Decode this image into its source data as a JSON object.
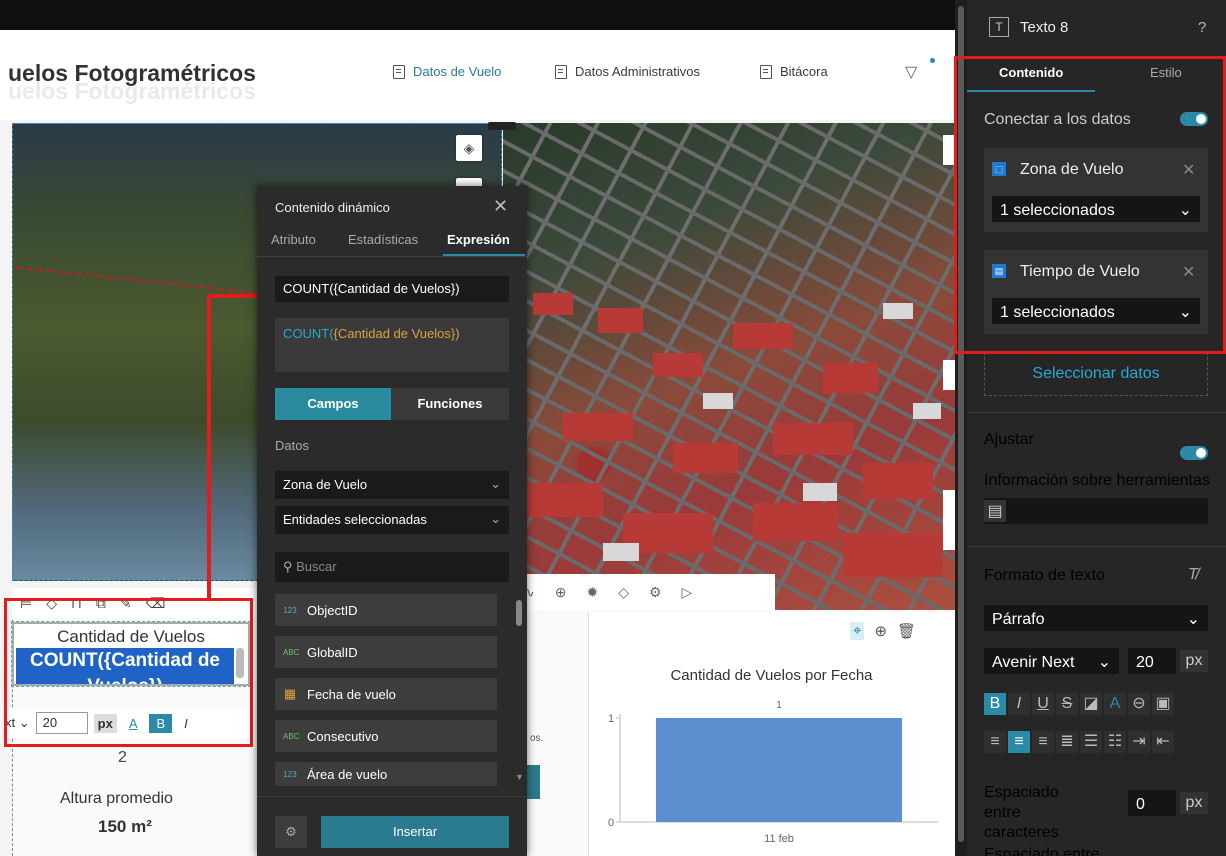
{
  "header": {
    "title": "uelos Fotogramétricos",
    "nav": [
      "Datos de Vuelo",
      "Datos Administrativos",
      "Bitácora"
    ]
  },
  "widget": {
    "label": "Cantidad de Vuelos",
    "expression_display": "COUNT({Cantidad de Vuelos})",
    "font_name": "xt",
    "font_size": "20",
    "unit": "px",
    "kpi_value": "2"
  },
  "kpi": {
    "label": "Altura promedio",
    "value": "150 m²"
  },
  "mini_text": "os.",
  "chart": {
    "title": "Cantidad de Vuelos por Fecha",
    "data_label": "1",
    "ticks": [
      "1",
      "0"
    ],
    "category": "11 feb"
  },
  "chart_data": {
    "type": "bar",
    "title": "Cantidad de Vuelos por Fecha",
    "categories": [
      "11 feb"
    ],
    "values": [
      1
    ],
    "ylim": [
      0,
      1
    ],
    "xlabel": "",
    "ylabel": "",
    "color": "#5b8fcf"
  },
  "popup": {
    "title": "Contenido dinámico",
    "tabs": [
      "Atributo",
      "Estadísticas",
      "Expresión"
    ],
    "expression": "COUNT({Cantidad de Vuelos})",
    "expression_fn": "COUNT(",
    "expression_arg": "{Cantidad de Vuelos})",
    "toggle": [
      "Campos",
      "Funciones"
    ],
    "datos_label": "Datos",
    "source": "Zona de Vuelo",
    "entities": "Entidades seleccionadas",
    "search_placeholder": "Buscar",
    "fields": [
      {
        "type": "123",
        "name": "ObjectID"
      },
      {
        "type": "ABC",
        "name": "GlobalID"
      },
      {
        "type": "date",
        "name": "Fecha de vuelo"
      },
      {
        "type": "ABC",
        "name": "Consecutivo"
      },
      {
        "type": "123",
        "name": "Área de vuelo"
      }
    ],
    "insert_label": "Insertar"
  },
  "panel": {
    "title": "Texto 8",
    "tabs": [
      "Contenido",
      "Estilo"
    ],
    "connect_label": "Conectar a los datos",
    "sources": [
      {
        "name": "Zona de Vuelo",
        "selection": "1 seleccionados"
      },
      {
        "name": "Tiempo de Vuelo",
        "selection": "1 seleccionados"
      }
    ],
    "select_data": "Seleccionar datos",
    "ajustar": "Ajustar",
    "tooltip_label": "Información sobre herramientas",
    "format_label": "Formato de texto",
    "paragraph": "Párrafo",
    "font": "Avenir Next",
    "size": "20",
    "unit": "px",
    "spacing_label": "Espaciado entre caracteres",
    "spacing_value": "0",
    "spacing2_label": "Espaciado entre"
  },
  "colors": {
    "accent": "#2a8aa8",
    "highlight": "#e51c1c",
    "bar": "#5b8fcf"
  }
}
